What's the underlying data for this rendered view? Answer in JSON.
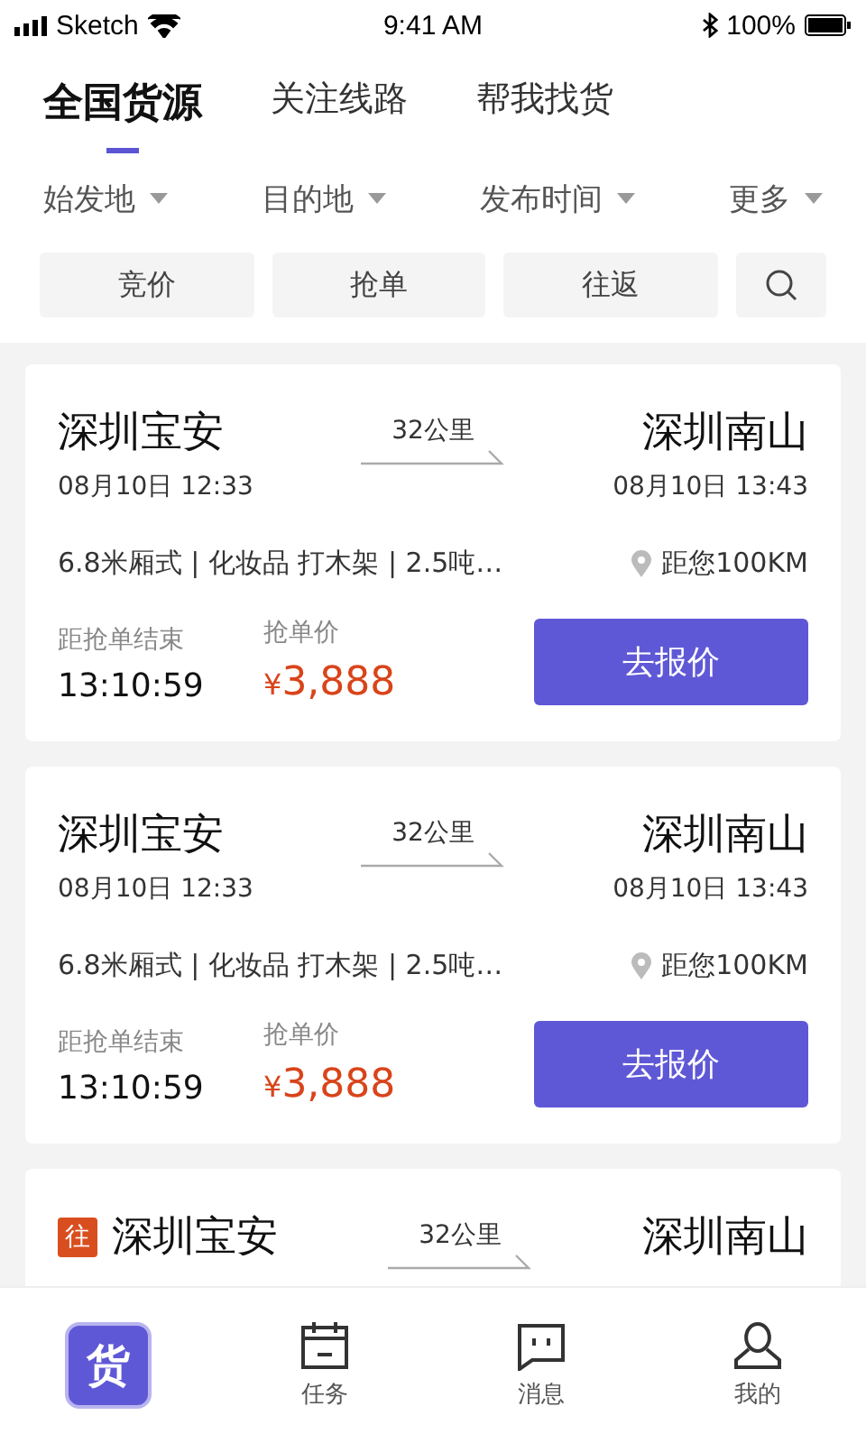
{
  "status_bar": {
    "carrier": "Sketch",
    "time": "9:41 AM",
    "battery": "100%"
  },
  "tabs": [
    {
      "label": "全国货源",
      "selected": true
    },
    {
      "label": "关注线路",
      "selected": false
    },
    {
      "label": "帮我找货",
      "selected": false
    }
  ],
  "filters": [
    "始发地",
    "目的地",
    "发布时间",
    "更多"
  ],
  "chips": [
    "竞价",
    "抢单",
    "往返"
  ],
  "cards": [
    {
      "origin": "深圳宝安",
      "origin_time": "08月10日 12:33",
      "distance": "32公里",
      "destination": "深圳南山",
      "destination_time": "08月10日 13:43",
      "details": "6.8米厢式 | 化妆品 打木架 | 2.5吨…",
      "nearby": "距您100KM",
      "countdown_label": "距抢单结束",
      "countdown": "13:10:59",
      "price_label": "抢单价",
      "currency": "¥",
      "price": "3,888",
      "action": "去报价"
    },
    {
      "origin": "深圳宝安",
      "origin_time": "08月10日 12:33",
      "distance": "32公里",
      "destination": "深圳南山",
      "destination_time": "08月10日 13:43",
      "details": "6.8米厢式 | 化妆品 打木架 | 2.5吨…",
      "nearby": "距您100KM",
      "countdown_label": "距抢单结束",
      "countdown": "13:10:59",
      "price_label": "抢单价",
      "currency": "¥",
      "price": "3,888",
      "action": "去报价"
    },
    {
      "tag": "往",
      "origin": "深圳宝安",
      "distance": "32公里",
      "destination": "深圳南山"
    }
  ],
  "nav": [
    {
      "kind": "home",
      "label": "货",
      "selected": true
    },
    {
      "kind": "task",
      "label": "任务",
      "selected": false
    },
    {
      "kind": "message",
      "label": "消息",
      "selected": false
    },
    {
      "kind": "profile",
      "label": "我的",
      "selected": false
    }
  ]
}
